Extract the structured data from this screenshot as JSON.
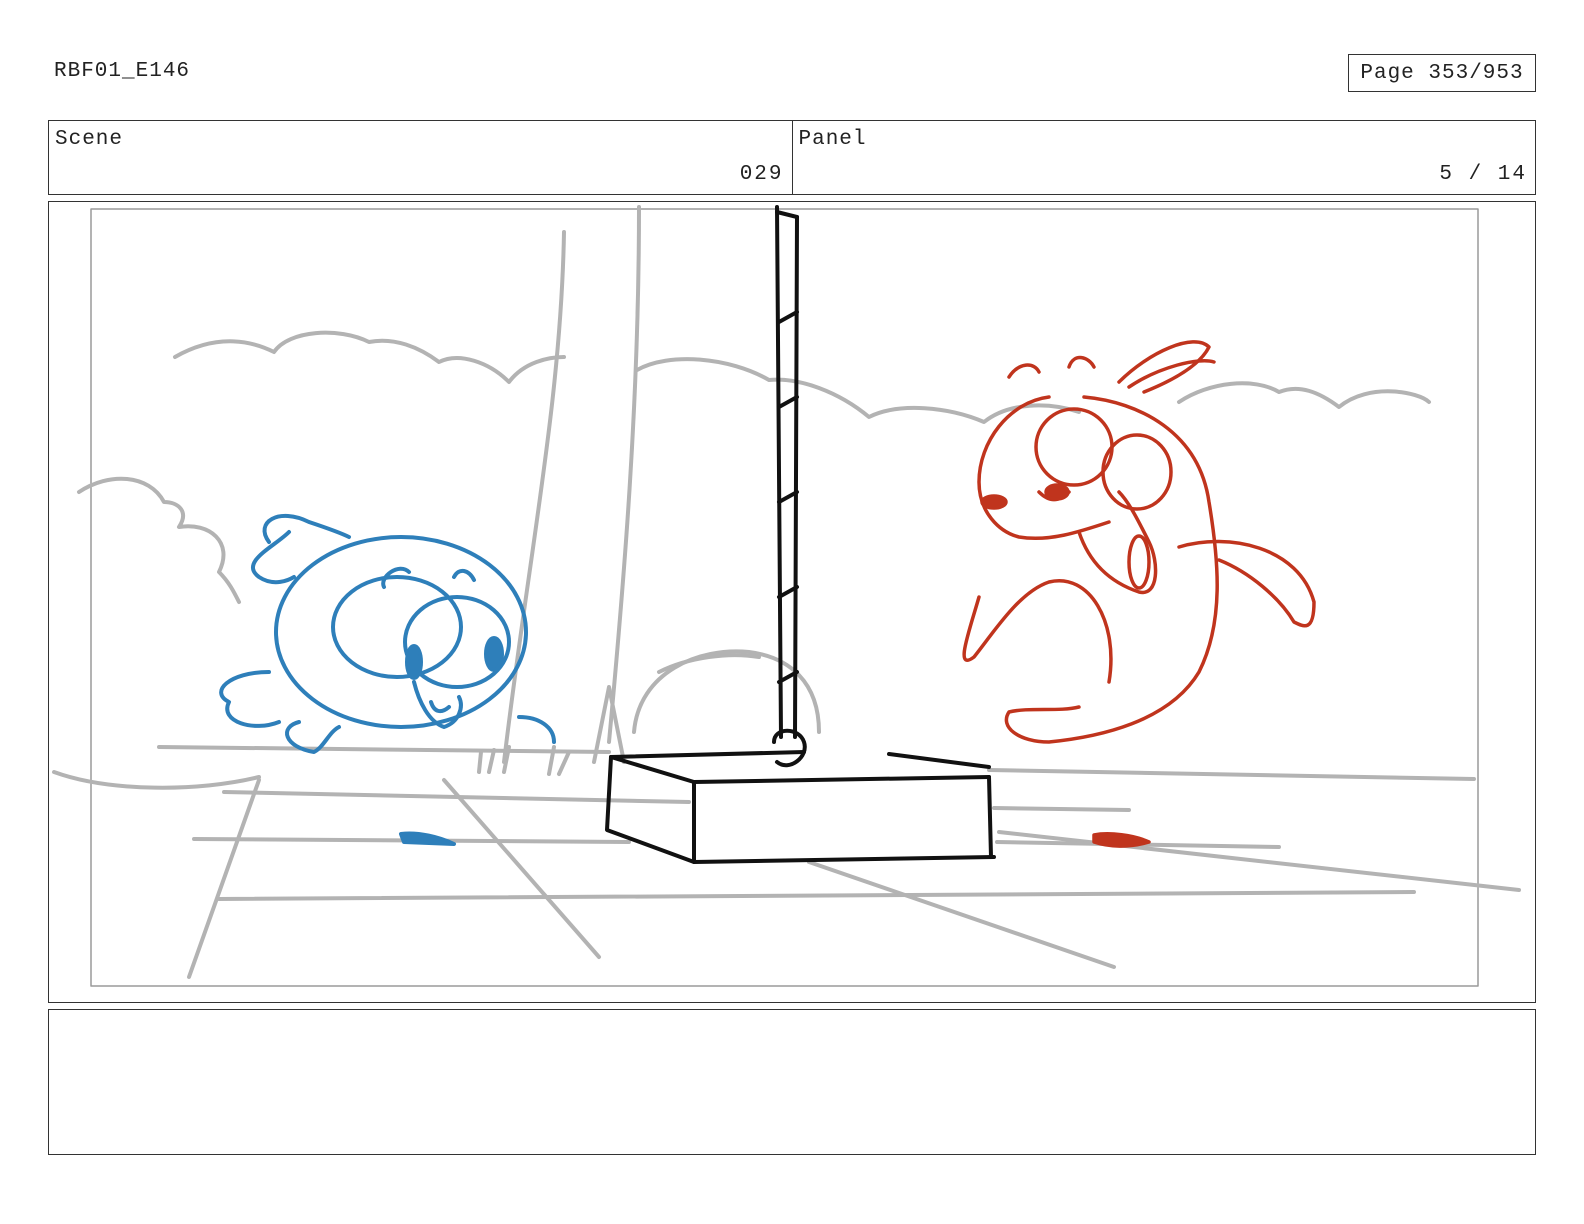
{
  "header": {
    "episode_code": "RBF01_E146",
    "page_label": "Page 353/953"
  },
  "scene": {
    "label": "Scene",
    "value": "029"
  },
  "panel": {
    "label": "Panel",
    "value": "5 / 14"
  },
  "notes": {
    "text": ""
  },
  "colors": {
    "left_character": "#2e7fba",
    "right_character": "#c0341d",
    "background_sketch": "#b3b3b3",
    "foreground_prop": "#111111"
  }
}
